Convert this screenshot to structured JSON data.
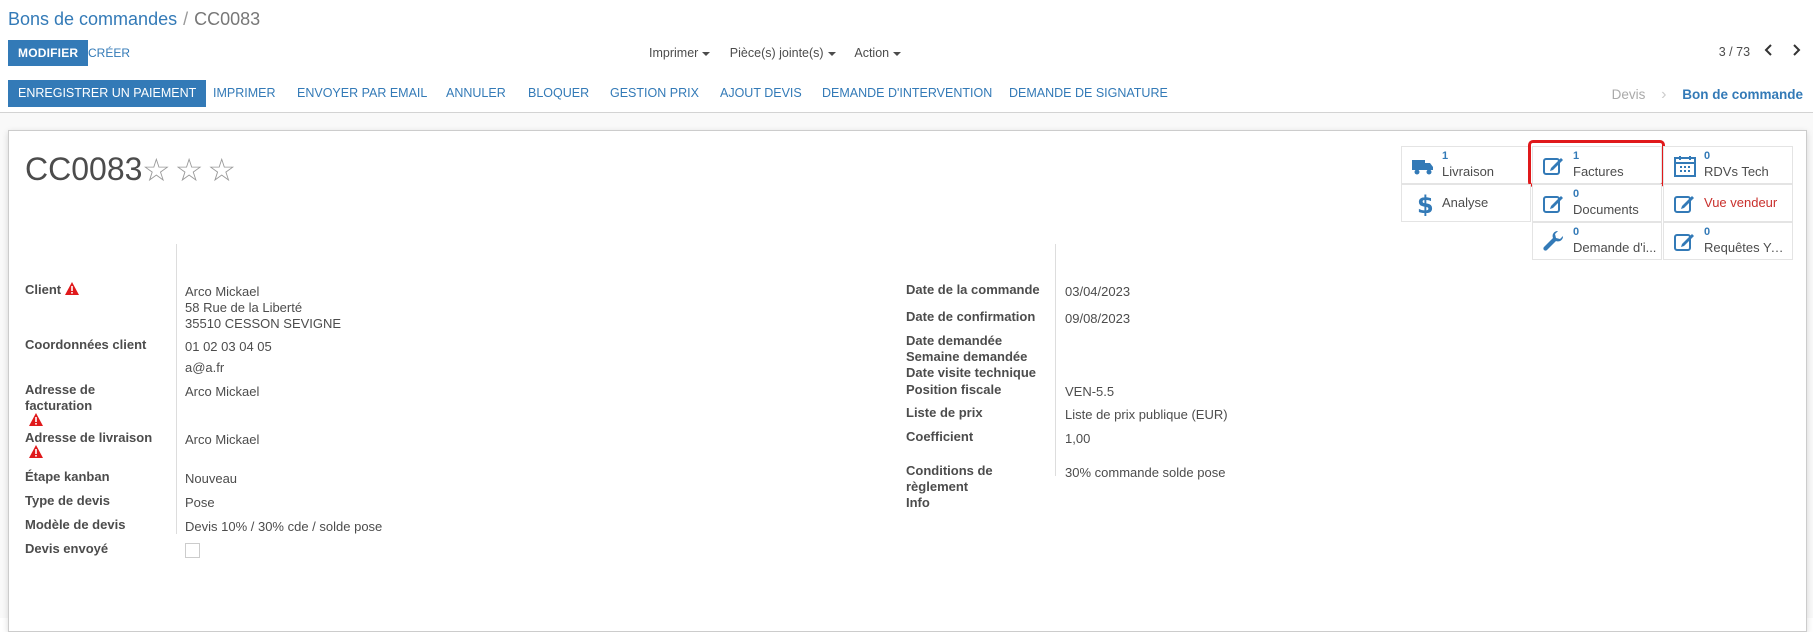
{
  "breadcrumb": {
    "parent": "Bons de commandes",
    "current": "CC0083"
  },
  "toolbar": {
    "edit_label": "MODIFIER",
    "create_label": "CRÉER",
    "print_label": "Imprimer",
    "attachments_label": "Pièce(s) jointe(s)",
    "action_label": "Action",
    "pager": "3 / 73",
    "prev": "‹",
    "next": "›"
  },
  "statusbar": {
    "buttons": [
      "ENREGISTRER UN PAIEMENT",
      "IMPRIMER",
      "ENVOYER PAR EMAIL",
      "ANNULER",
      "BLOQUER",
      "GESTION PRIX",
      "AJOUT DEVIS",
      "DEMANDE D'INTERVENTION",
      "DEMANDE DE SIGNATURE"
    ],
    "stage_inactive": "Devis",
    "stage_active": "Bon de commande"
  },
  "record": {
    "name": "CC0083",
    "stars": "☆☆☆"
  },
  "smart_buttons": {
    "livraison": {
      "value": "1",
      "label": "Livraison"
    },
    "factures": {
      "value": "1",
      "label": "Factures"
    },
    "rdvs": {
      "value": "0",
      "label": "RDVs Tech"
    },
    "analyse": {
      "label": "Analyse"
    },
    "documents": {
      "value": "0",
      "label": "Documents"
    },
    "vue_vendeur": {
      "label": "Vue vendeur"
    },
    "intervention": {
      "value": "0",
      "label": "Demande d'i..."
    },
    "requetes": {
      "value": "0",
      "label": "Requêtes Yo..."
    }
  },
  "left_fields": {
    "client_label": "Client",
    "client_name": "Arco Mickael",
    "client_street": "58 Rue de la Liberté",
    "client_city": "35510 CESSON SEVIGNE",
    "coords_label": "Coordonnées client",
    "phone": "01 02 03 04 05",
    "email": "a@a.fr",
    "billing_label_1": "Adresse de",
    "billing_label_2": "facturation",
    "billing_value": "Arco Mickael",
    "shipping_label": "Adresse de livraison",
    "shipping_value": "Arco Mickael",
    "kanban_label": "Étape kanban",
    "kanban_value": "Nouveau",
    "type_label": "Type de devis",
    "type_value": "Pose",
    "model_label": "Modèle de devis",
    "model_value": "Devis 10% / 30% cde / solde pose",
    "sent_label": "Devis envoyé"
  },
  "right_fields": {
    "order_date_label": "Date de la commande",
    "order_date": "03/04/2023",
    "confirm_date_label": "Date de confirmation",
    "confirm_date": "09/08/2023",
    "requested_date_label": "Date demandée",
    "requested_week_label": "Semaine demandée",
    "tech_visit_label": "Date visite technique",
    "fiscal_label": "Position fiscale",
    "fiscal_value": "VEN-5.5",
    "pricelist_label": "Liste de prix",
    "pricelist_value": "Liste de prix publique (EUR)",
    "coef_label": "Coefficient",
    "coef_value": "1,00",
    "payment_label_1": "Conditions de",
    "payment_label_2": "règlement",
    "payment_value": "30% commande solde pose",
    "info_label": "Info"
  },
  "colors": {
    "primary": "#337ab7",
    "highlight": "#e0191b",
    "warning": "#e0191b"
  }
}
